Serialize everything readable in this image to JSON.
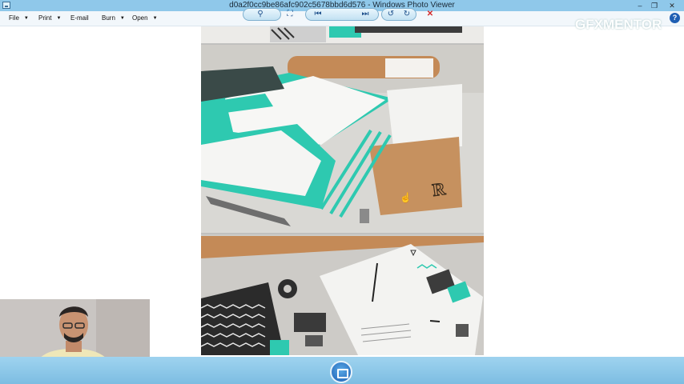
{
  "window": {
    "title": "d0a2f0cc9be86afc902c5678bbd6d576 - Windows Photo Viewer",
    "minimize_glyph": "–",
    "maximize_glyph": "❐",
    "close_glyph": "✕"
  },
  "menu": {
    "items": [
      {
        "label": "File",
        "has_dropdown": true
      },
      {
        "label": "Print",
        "has_dropdown": true
      },
      {
        "label": "E-mail",
        "has_dropdown": false
      },
      {
        "label": "Burn",
        "has_dropdown": true
      },
      {
        "label": "Open",
        "has_dropdown": true
      }
    ],
    "help_glyph": "?"
  },
  "watermark": {
    "text": "GFXMENTOR"
  },
  "toolbar": {
    "zoom_glyph": "⚲",
    "fit_glyph": "⛶",
    "previous_glyph": "⏮",
    "next_glyph": "⏭",
    "rotate_ccw_glyph": "↺",
    "rotate_cw_glyph": "↻",
    "delete_glyph": "✕"
  },
  "colors": {
    "titlebar": "#8fc8ea",
    "toolbar": "#7dbde2",
    "accent_teal": "#2ec9b0",
    "kraft": "#c6915f"
  },
  "icons": [
    "app-icon",
    "help-icon",
    "zoom-icon",
    "fit-window-icon",
    "previous-icon",
    "slideshow-icon",
    "next-icon",
    "rotate-ccw-icon",
    "rotate-cw-icon",
    "delete-icon"
  ]
}
